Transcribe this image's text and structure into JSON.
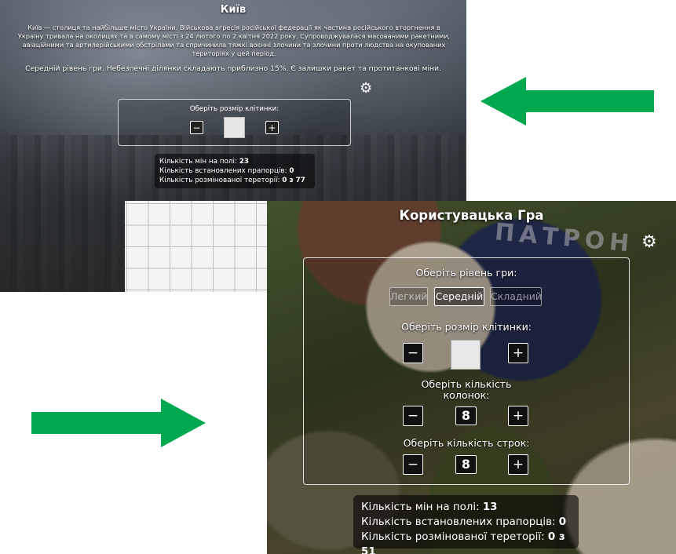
{
  "kyiv": {
    "title": "Київ",
    "description": "Київ — столиця та найбільше місто України. Військова агресія російської федерації як частина російського вторгнення в Україну тривала на околицях та в самому місті з 24 лютого по 2 квітня 2022 року. Супроводжувалася масованими ракетними, авіаційними та артилерійськими обстрілами та спричинила тяжкі воєнні злочини та злочини проти людства на окупованих територіях у цей період.",
    "level_text": "Середній рівень гри. Небезпечні ділянки складають приблизно 15%. Є залишки ракет та протитанкові міни.",
    "cell_size_label": "Оберіть розмір клітинки:",
    "minus": "−",
    "plus": "+",
    "stats": {
      "mines_label": "Кількість мін на полі:",
      "mines_value": "23",
      "flags_label": "Кількість встановлених прапорців:",
      "flags_value": "0",
      "cleared_label": "Кількість розмінованої тереторії:",
      "cleared_value": "0 з 77"
    }
  },
  "custom": {
    "title": "Користувацька Гра",
    "background_word": "ПАТРОН",
    "level_label": "Оберіть рівень гри:",
    "levels": [
      "Легкий",
      "Середній",
      "Складний"
    ],
    "selected_level": "Середній",
    "cell_size_label": "Оберіть розмір клітинки:",
    "columns_label": "Оберіть кількість колонок:",
    "columns_value": "8",
    "rows_label": "Оберіть кількість строк:",
    "rows_value": "8",
    "minus": "−",
    "plus": "+",
    "stats": {
      "mines_label": "Кількість мін на полі:",
      "mines_value": "13",
      "flags_label": "Кількість встановлених прапорців:",
      "flags_value": "0",
      "cleared_label": "Кількість розмінованої тереторії:",
      "cleared_value": "0 з 51"
    }
  },
  "colors": {
    "arrow": "#00a84f"
  },
  "icons": [
    "gear-icon",
    "arrow-left-icon",
    "arrow-right-icon"
  ]
}
